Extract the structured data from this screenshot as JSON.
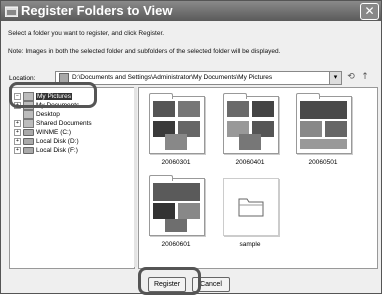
{
  "window": {
    "title": "Register Folders to View",
    "close_glyph": "✕",
    "icon": "folder-register-icon"
  },
  "instructions": {
    "line1": "Select a folder you want to register, and click Register.",
    "line2": "Note: Images in both the selected folder and subfolders of the selected folder will be displayed."
  },
  "location": {
    "label": "Location:",
    "path": "D:\\Documents and Settings\\Administrator\\My Documents\\My Pictures",
    "dropdown_glyph": "▾"
  },
  "toolbar": {
    "back_glyph": "⟲",
    "up_glyph": "↑"
  },
  "tree": {
    "items": [
      {
        "label": "My Pictures",
        "toggle": "−",
        "selected": true
      },
      {
        "label": "My Documents",
        "toggle": "+",
        "selected": false
      },
      {
        "label": "Desktop",
        "toggle": "",
        "selected": false
      },
      {
        "label": "Shared Documents",
        "toggle": "+",
        "selected": false
      },
      {
        "label": "WINME (C:)",
        "toggle": "+",
        "selected": false
      },
      {
        "label": "Local Disk (D:)",
        "toggle": "+",
        "selected": false
      },
      {
        "label": "Local Disk (F:)",
        "toggle": "+",
        "selected": false
      }
    ]
  },
  "folders": [
    {
      "name": "20060301",
      "has_images": true
    },
    {
      "name": "20060401",
      "has_images": true
    },
    {
      "name": "20060501",
      "has_images": true
    },
    {
      "name": "20060601",
      "has_images": true
    },
    {
      "name": "sample",
      "has_images": false
    }
  ],
  "buttons": {
    "register": "Register",
    "cancel": "Cancel"
  }
}
